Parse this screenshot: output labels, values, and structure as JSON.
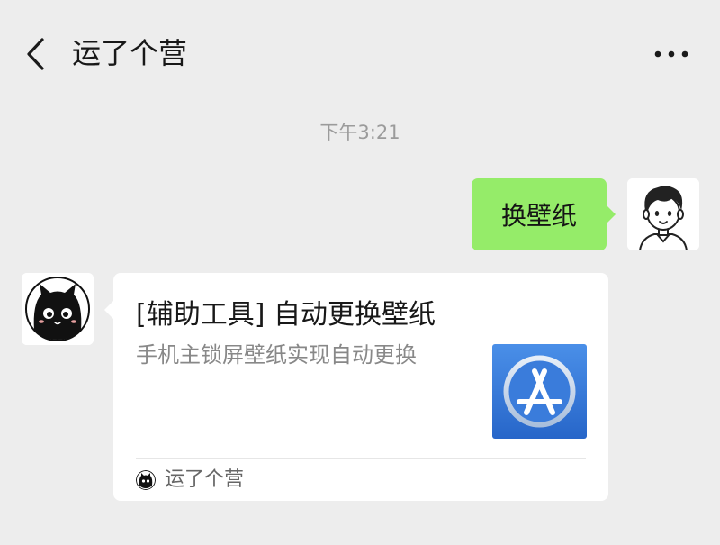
{
  "header": {
    "back_icon": "chevron-left-icon",
    "title": "运了个营",
    "more_icon": "ellipsis-icon"
  },
  "messages": {
    "timestamp": "下午3:21",
    "outgoing": {
      "text": "换壁纸",
      "bubble_color": "#95ec69"
    },
    "incoming_card": {
      "title": "[辅助工具] 自动更换壁纸",
      "description": "手机主锁屏壁纸实现自动更换",
      "thumbnail_icon": "app-store-icon",
      "source_name": "运了个营"
    }
  },
  "colors": {
    "background": "#ededed",
    "accent_green": "#95ec69",
    "app_store_blue": "#2f74d6"
  }
}
